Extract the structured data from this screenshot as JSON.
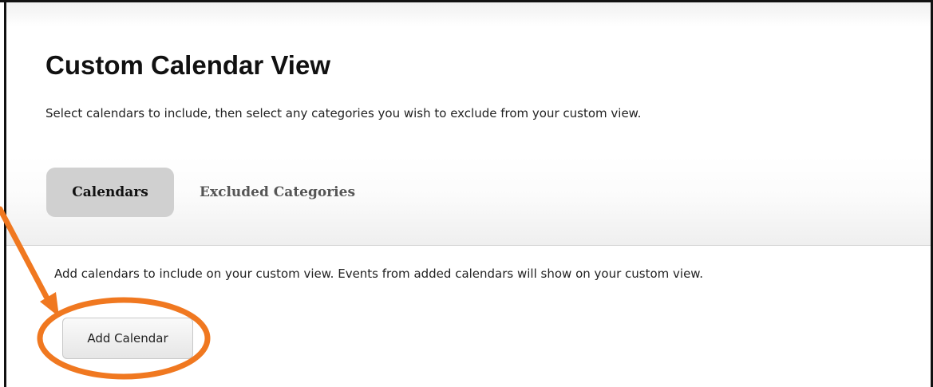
{
  "page": {
    "title": "Custom Calendar View",
    "description": "Select calendars to include, then select any categories you wish to exclude from your custom view."
  },
  "tabs": [
    {
      "label": "Calendars",
      "active": true
    },
    {
      "label": "Excluded Categories",
      "active": false
    }
  ],
  "calendars_panel": {
    "instructions": "Add calendars to include on your custom view. Events from added calendars will show on your custom view.",
    "add_button_label": "Add Calendar"
  },
  "annotation": {
    "color": "#f07820",
    "shapes": [
      "arrow",
      "ellipse"
    ]
  }
}
